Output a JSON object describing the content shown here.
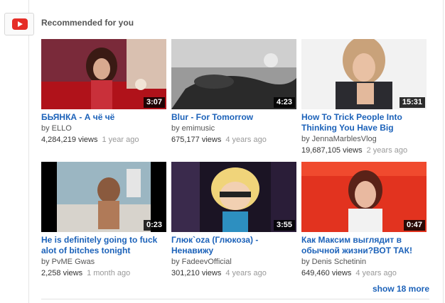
{
  "section": {
    "title": "Recommended for you",
    "show_more": "show 18 more"
  },
  "videos": [
    {
      "title": "БЬЯНКА - А чё чё",
      "channel": "by ELLO",
      "views": "4,284,219 views",
      "age": "1 year ago",
      "duration": "3:07"
    },
    {
      "title": "Blur - For Tomorrow",
      "channel": "by emimusic",
      "views": "675,177 views",
      "age": "4 years ago",
      "duration": "4:23"
    },
    {
      "title": "How To Trick People Into Thinking You Have Big",
      "channel": "by JennaMarblesVlog",
      "views": "19,687,105 views",
      "age": "2 years ago",
      "duration": "15:31"
    },
    {
      "title": "He is definitely going to fuck alot of bitches tonight",
      "channel": "by PvME Gwas",
      "views": "2,258 views",
      "age": "1 month ago",
      "duration": "0:23"
    },
    {
      "title": "Глюк`oza (Глюкоза) - Ненавижу",
      "channel": "by FadeevOfficial",
      "views": "301,210 views",
      "age": "4 years ago",
      "duration": "3:55"
    },
    {
      "title": "Как Максим выглядит в обычной жизни?ВОТ ТАК!",
      "channel": "by Denis Schetinin",
      "views": "649,460 views",
      "age": "4 years ago",
      "duration": "0:47"
    }
  ],
  "colors": {
    "link": "#1c62b9",
    "youtube_red": "#e52d27"
  }
}
